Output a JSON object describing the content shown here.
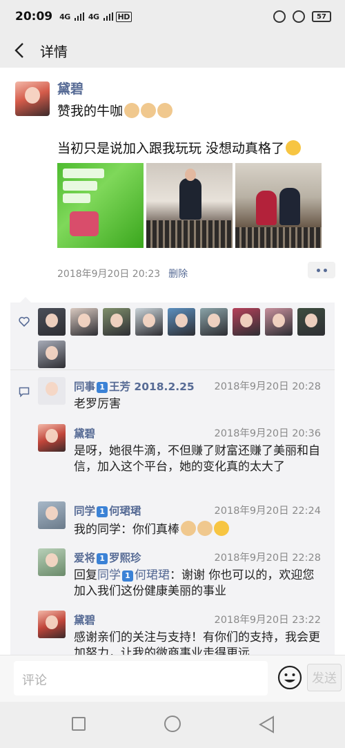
{
  "status_bar": {
    "time": "20:09",
    "signal_1": "4G",
    "signal_2": "4G",
    "hd_label": "HD",
    "battery": "57"
  },
  "header": {
    "title": "详情"
  },
  "post": {
    "author": "黛碧",
    "text_line_1": "赞我的牛咖",
    "text_line_2": "当初只是说加入跟我玩玩 没想动真格了",
    "timestamp": "2018年9月20日 20:23",
    "delete_label": "删除"
  },
  "likes": {
    "avatar_colors": [
      "#4a4e58",
      "#d9c9c0",
      "#7f8f6b",
      "#c9d3d8",
      "#5b8fbf",
      "#8aa3a8",
      "#b5415a",
      "#c78f9c",
      "#3d4d3f",
      "#a8acb8"
    ]
  },
  "comments": [
    {
      "name": "同事1️⃣王芳 2018.2.25",
      "name_prefix": "同事",
      "name_suffix": "王芳 2018.2.25",
      "time": "2018年9月20日 20:28",
      "text": "老罗厉害",
      "avatar_color": "#e8e8ec"
    },
    {
      "name": "黛碧",
      "time": "2018年9月20日 20:36",
      "text": "是呀，她很牛滴，不但赚了财富还赚了美丽和自信，加入这个平台，她的变化真的太大了",
      "avatar_color": "#c0453a"
    },
    {
      "name_prefix": "同学",
      "name_suffix": "何珺珺",
      "time": "2018年9月20日 22:24",
      "text": "我的同学：你们真棒",
      "avatar_color": "#7a8a9a"
    },
    {
      "name_prefix": "爱将",
      "name_suffix": "罗熙珍",
      "time": "2018年9月20日 22:28",
      "reply_prefix": "回复",
      "reply_to_prefix": "同学",
      "reply_to_suffix": "何珺珺",
      "text": "：谢谢 你也可以的，欢迎您加入我们这份健康美丽的事业",
      "avatar_color": "#8aa38a"
    },
    {
      "name": "黛碧",
      "time": "2018年9月20日 23:22",
      "text": "感谢亲们的关注与支持！有你们的支持，我会更加努力，让我的微商事业走得更远",
      "avatar_color": "#c0453a"
    }
  ],
  "comment_bar": {
    "placeholder": "评论",
    "send_label": "发送"
  },
  "badge_number": "1"
}
